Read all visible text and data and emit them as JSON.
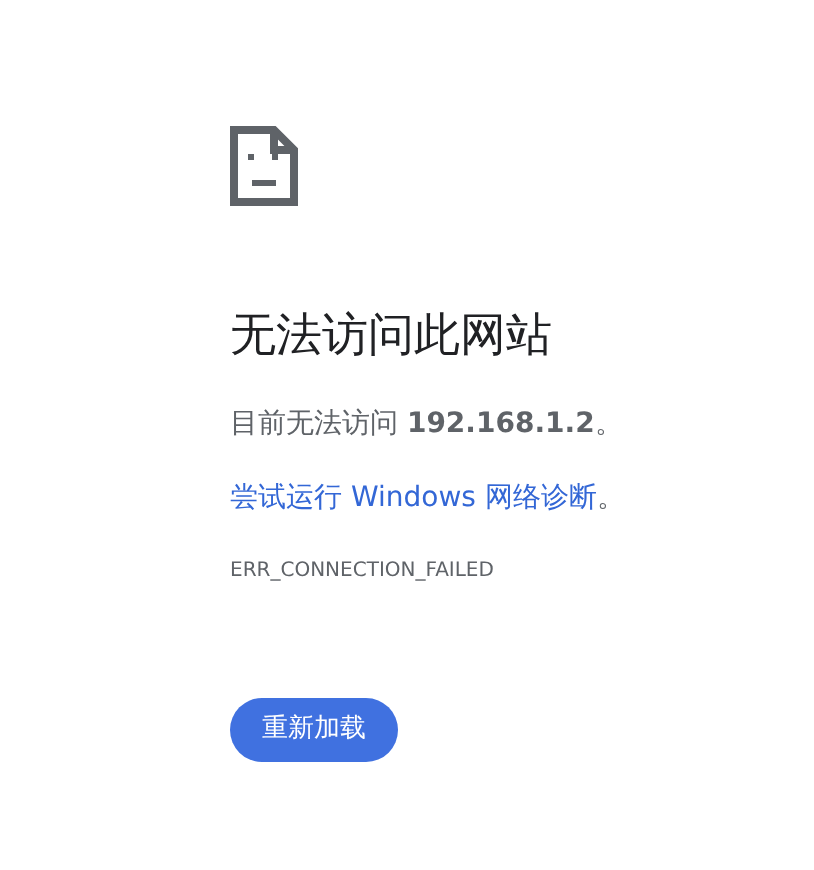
{
  "title": "无法访问此网站",
  "description": "目前无法访问 **192.168.1.2**。",
  "suggestion": {
    "link": "尝试运行 Windows 网络诊断",
    "suffix": "。"
  },
  "error_code": "ERR_CONNECTION_FAILED",
  "reload_button": "重新加载"
}
